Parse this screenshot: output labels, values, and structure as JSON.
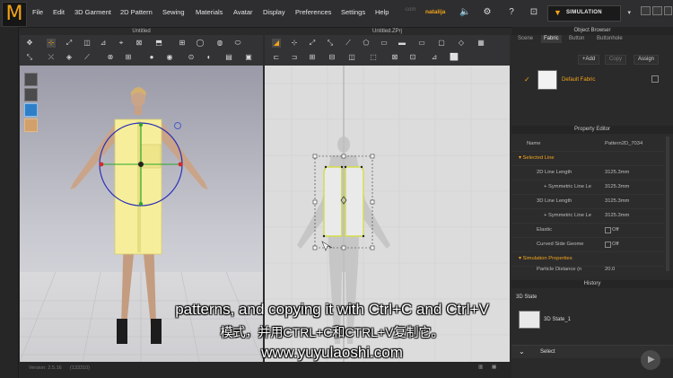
{
  "app": {
    "logo": "M",
    "menu": [
      "File",
      "Edit",
      "3D Garment",
      "2D Pattern",
      "Sewing",
      "Materials",
      "Avatar",
      "Display",
      "Preferences",
      "Settings",
      "Help"
    ],
    "user": {
      "avatar_text": "·com",
      "name": "natalija"
    },
    "simulation_label": "SIMULATION",
    "accent": "#f2a417"
  },
  "view3d": {
    "title": "Untitled"
  },
  "view2d": {
    "title": "Untitled.ZPrj"
  },
  "object_browser": {
    "title": "Object Browser",
    "tabs": [
      "Scene",
      "Fabric",
      "Button",
      "Buttonhole"
    ],
    "active_tab": "Fabric",
    "buttons": {
      "add": "+Add",
      "copy": "Copy",
      "assign": "Assign"
    },
    "fabric_name": "Default Fabric"
  },
  "property_editor": {
    "title": "Property Editor",
    "name_label": "Name",
    "name_value": "Pattern2D_7034",
    "section_selected_line": "Selected Line",
    "rows": [
      {
        "label": "2D Line Length",
        "value": "3125.3mm"
      },
      {
        "label": "+ Symmetric Line Le",
        "value": "3125.3mm"
      },
      {
        "label": "3D Line Length",
        "value": "3125.3mm"
      },
      {
        "label": "+ Symmetric Line Le",
        "value": "3125.3mm"
      },
      {
        "label": "Elastic",
        "value": "Off"
      },
      {
        "label": "Curved Side Geome",
        "value": "Off"
      }
    ],
    "section_simulation": "Simulation Properties",
    "cut_label": "Particle Distance (n",
    "cut_value": "20.0"
  },
  "history": {
    "title": "History",
    "state_label": "3D State",
    "item": "3D State_1",
    "select_label": "Select"
  },
  "status": {
    "version": "Version: 2.5.16",
    "extra": "(133310)"
  },
  "subtitles": {
    "line1": "patterns, and copying it with Ctrl+C and Ctrl+V",
    "line2": "模式，并用CTRL+C和CTRL+V复制它。",
    "line3": "www.yuyulaoshi.com"
  }
}
